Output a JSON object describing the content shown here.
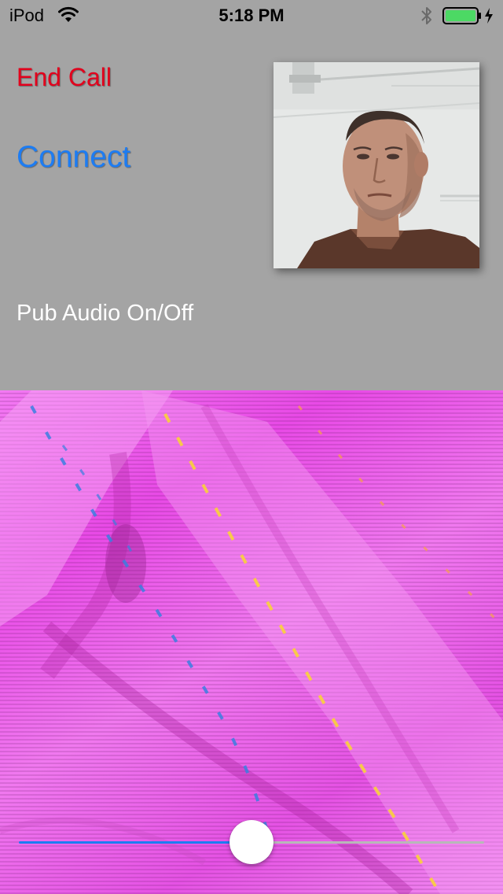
{
  "status_bar": {
    "carrier": "iPod",
    "time": "5:18 PM",
    "wifi_icon": "wifi-icon",
    "bluetooth_icon": "bluetooth-icon",
    "battery_icon": "battery-icon",
    "battery_color": "#4cd964",
    "charging_icon": "charging-bolt-icon"
  },
  "controls": {
    "end_call_label": "End Call",
    "end_call_color": "#e2001c",
    "connect_label": "Connect",
    "connect_color": "#1d7cf2",
    "pub_audio_label": "Pub Audio On/Off"
  },
  "slider": {
    "value": 0.5,
    "filled_color": "#1d7cf2",
    "empty_color": "#b8b8b8"
  },
  "colors": {
    "background": "#a4a4a4"
  }
}
